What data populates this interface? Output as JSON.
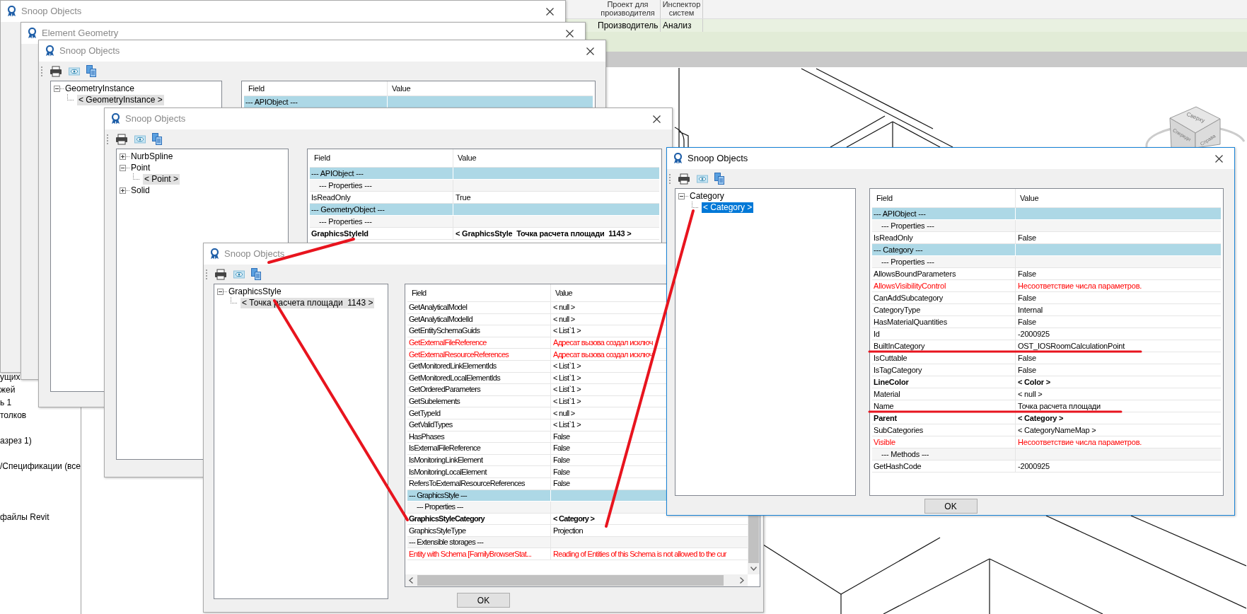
{
  "ribbon": {
    "panels": [
      {
        "label": "Проект для производителя"
      },
      {
        "label": "Инспектор систем"
      }
    ],
    "tabs": [
      {
        "label": "Производитель"
      },
      {
        "label": "Анализ"
      }
    ]
  },
  "project_browser": {
    "items": [
      "ущих",
      "жей",
      "ь 1",
      "толков",
      "азрез 1)",
      "/Спецификации (все",
      "файлы Revit"
    ]
  },
  "view_cube": {
    "faces": [
      "Сверху",
      "Спереди",
      "Справа"
    ]
  },
  "windows": [
    {
      "title": "Snoop Objects",
      "active": false
    },
    {
      "title": "Element Geometry",
      "active": false
    },
    {
      "title": "Snoop Objects",
      "active": false,
      "tree": [
        {
          "label": "GeometryInstance",
          "expanded": true,
          "selected": false,
          "children": [
            {
              "label": "< GeometryInstance >",
              "selected": true
            }
          ]
        }
      ],
      "table": {
        "columns": [
          "Field",
          "Value"
        ],
        "rows": [
          {
            "kind": "section",
            "field": "--- APIObject ---"
          }
        ]
      }
    },
    {
      "title": "Snoop Objects",
      "active": false,
      "tree": [
        {
          "label": "NurbSpline",
          "expanded": false,
          "selected": false
        },
        {
          "label": "Point",
          "expanded": true,
          "selected": false,
          "children": [
            {
              "label": "< Point >",
              "selected": true
            }
          ]
        },
        {
          "label": "Solid",
          "expanded": false,
          "selected": false
        }
      ],
      "table": {
        "columns": [
          "Field",
          "Value"
        ],
        "rows": [
          {
            "kind": "section",
            "field": "--- APIObject ---"
          },
          {
            "kind": "subsection",
            "field": "--- Properties ---"
          },
          {
            "kind": "value",
            "field": "IsReadOnly",
            "value": "True"
          },
          {
            "kind": "section",
            "field": "--- GeometryObject ---"
          },
          {
            "kind": "subsection",
            "field": "--- Properties ---"
          },
          {
            "kind": "object",
            "field": "GraphicsStyleId",
            "value": "< GraphicsStyle  Точка расчета площади  1143 >"
          }
        ]
      }
    },
    {
      "title": "Snoop Objects",
      "active": false,
      "tree": [
        {
          "label": "GraphicsStyle",
          "expanded": true,
          "selected": false,
          "children": [
            {
              "label": "< Точка расчета площади  1143 >",
              "selected": true
            }
          ]
        }
      ],
      "table": {
        "columns": [
          "Field",
          "Value"
        ],
        "rows": [
          {
            "kind": "value",
            "field": "GetAnalyticalModel",
            "value": "< null >"
          },
          {
            "kind": "value",
            "field": "GetAnalyticalModelId",
            "value": "< null >"
          },
          {
            "kind": "value",
            "field": "GetEntitySchemaGuids",
            "value": "< List`1 >"
          },
          {
            "kind": "error",
            "field": "GetExternalFileReference",
            "value": "Адресат вызова создал исключ"
          },
          {
            "kind": "error",
            "field": "GetExternalResourceReferences",
            "value": "Адресат вызова создал исключ"
          },
          {
            "kind": "value",
            "field": "GetMonitoredLinkElementIds",
            "value": "< List`1 >"
          },
          {
            "kind": "value",
            "field": "GetMonitoredLocalElementIds",
            "value": "< List`1 >"
          },
          {
            "kind": "value",
            "field": "GetOrderedParameters",
            "value": "< List`1 >"
          },
          {
            "kind": "value",
            "field": "GetSubelements",
            "value": "< List`1 >"
          },
          {
            "kind": "value",
            "field": "GetTypeId",
            "value": "< null >"
          },
          {
            "kind": "value",
            "field": "GetValidTypes",
            "value": "< List`1 >"
          },
          {
            "kind": "value",
            "field": "HasPhases",
            "value": "False"
          },
          {
            "kind": "value",
            "field": "IsExternalFileReference",
            "value": "False"
          },
          {
            "kind": "value",
            "field": "IsMonitoringLinkElement",
            "value": "False"
          },
          {
            "kind": "value",
            "field": "IsMonitoringLocalElement",
            "value": "False"
          },
          {
            "kind": "value",
            "field": "RefersToExternalResourceReferences",
            "value": "False"
          },
          {
            "kind": "section",
            "field": "--- GraphicsStyle ---"
          },
          {
            "kind": "subsection",
            "field": "--- Properties ---"
          },
          {
            "kind": "object",
            "field": "GraphicsStyleCategory",
            "value": "< Category >"
          },
          {
            "kind": "value",
            "field": "GraphicsStyleType",
            "value": "Projection"
          },
          {
            "kind": "group",
            "field": "--- Extensible storages ---"
          },
          {
            "kind": "error",
            "field": "Entity with Schema [FamilyBrowserStat...",
            "value": "Reading of Entities of this Schema is not allowed to the cur"
          }
        ]
      },
      "ok_button": "OK"
    },
    {
      "title": "Snoop Objects",
      "active": true,
      "tree": [
        {
          "label": "Category",
          "expanded": true,
          "selected": false,
          "children": [
            {
              "label": "< Category >",
              "selected": true
            }
          ]
        }
      ],
      "table": {
        "columns": [
          "Field",
          "Value"
        ],
        "rows": [
          {
            "kind": "section",
            "field": "--- APIObject ---"
          },
          {
            "kind": "subsection",
            "field": "--- Properties ---"
          },
          {
            "kind": "value",
            "field": "IsReadOnly",
            "value": "False"
          },
          {
            "kind": "section",
            "field": "--- Category ---"
          },
          {
            "kind": "subsection",
            "field": "--- Properties ---"
          },
          {
            "kind": "value",
            "field": "AllowsBoundParameters",
            "value": "False"
          },
          {
            "kind": "error",
            "field": "AllowsVisibilityControl",
            "value": "Несоответствие числа параметров."
          },
          {
            "kind": "value",
            "field": "CanAddSubcategory",
            "value": "False"
          },
          {
            "kind": "value",
            "field": "CategoryType",
            "value": "Internal"
          },
          {
            "kind": "value",
            "field": "HasMaterialQuantities",
            "value": "False"
          },
          {
            "kind": "value",
            "field": "Id",
            "value": "-2000925"
          },
          {
            "kind": "value",
            "field": "BuiltInCategory",
            "value": "OST_IOSRoomCalculationPoint"
          },
          {
            "kind": "value",
            "field": "IsCuttable",
            "value": "False"
          },
          {
            "kind": "value",
            "field": "IsTagCategory",
            "value": "False"
          },
          {
            "kind": "object",
            "field": "LineColor",
            "value": "< Color >"
          },
          {
            "kind": "value",
            "field": "Material",
            "value": "< null >"
          },
          {
            "kind": "value",
            "field": "Name",
            "value": "Точка расчета площади"
          },
          {
            "kind": "object",
            "field": "Parent",
            "value": "< Category >"
          },
          {
            "kind": "value",
            "field": "SubCategories",
            "value": "< CategoryNameMap >"
          },
          {
            "kind": "error",
            "field": "Visible",
            "value": "Несоответствие числа параметров."
          },
          {
            "kind": "subsection",
            "field": "--- Methods ---"
          },
          {
            "kind": "value",
            "field": "GetHashCode",
            "value": "-2000925"
          }
        ]
      },
      "ok_button": "OK"
    }
  ]
}
